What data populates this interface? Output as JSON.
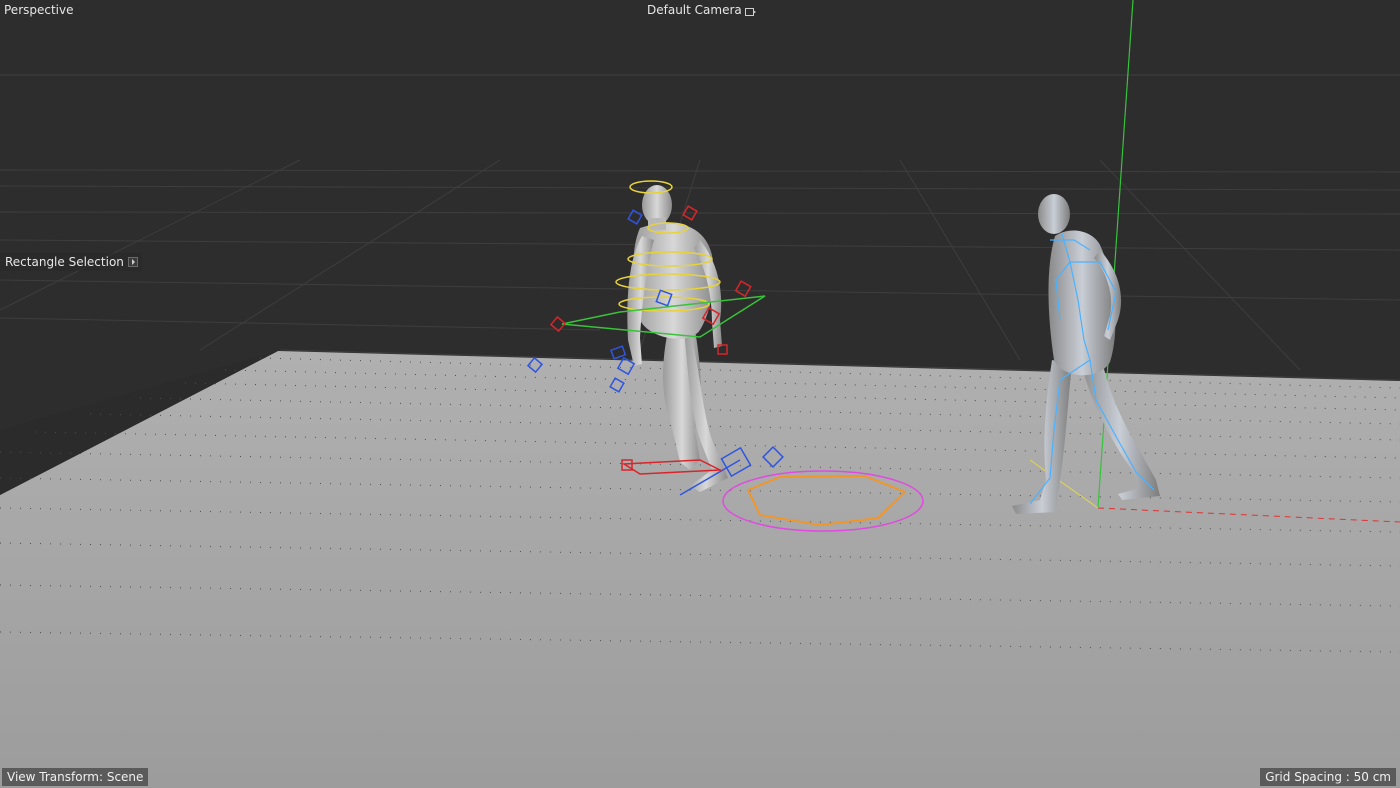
{
  "viewport": {
    "view_name": "Perspective",
    "camera_name": "Default Camera",
    "camera_icon": "camera-lock-icon",
    "selection_tool": "Rectangle Selection",
    "view_transform": "View Transform: Scene",
    "grid_spacing": "Grid Spacing : 50 cm"
  },
  "scene": {
    "sky_color": "#2d2d2d",
    "floor_color": "#a3a3a3",
    "objects": [
      "rigged-character",
      "reference-character",
      "character-root-controller",
      "y-axis-line",
      "x-axis-line"
    ]
  },
  "colors": {
    "rig_yellow": "#e8d23a",
    "rig_red": "#d8252a",
    "rig_blue": "#2f55e0",
    "rig_green": "#39c23a",
    "rig_magenta": "#e04ae0",
    "rig_orange": "#f0962a",
    "skeleton_cyan": "#4ab2ff",
    "axis_green": "#37c23d",
    "axis_red": "#e03232"
  }
}
